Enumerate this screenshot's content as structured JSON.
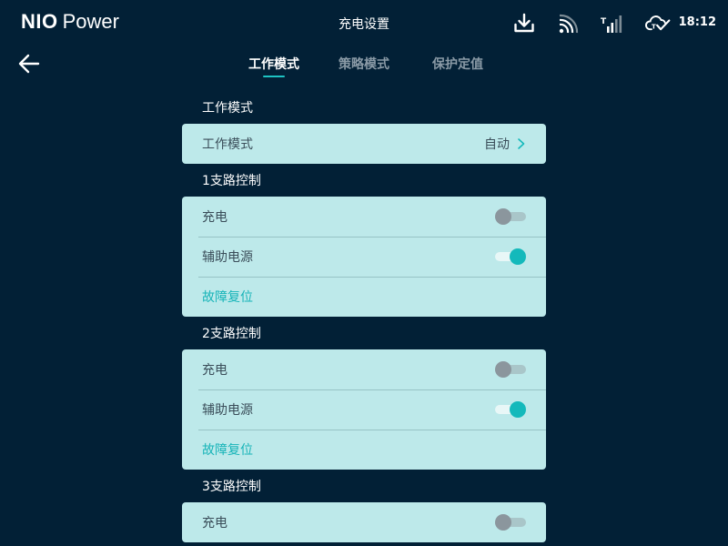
{
  "status_bar": {
    "logo_brand": "NIO",
    "logo_product": "Power",
    "title": "充电设置",
    "time": "18:12",
    "icons": [
      "download-icon",
      "wireless-signal-icon",
      "cellular-signal-icon",
      "cloud-check-icon"
    ]
  },
  "nav": {
    "back_icon": "arrow-left-icon",
    "tabs": [
      {
        "label": "工作模式",
        "active": true
      },
      {
        "label": "策略模式",
        "active": false
      },
      {
        "label": "保护定值",
        "active": false
      }
    ]
  },
  "sections": {
    "work_mode": {
      "label": "工作模式",
      "row_label": "工作模式",
      "row_value": "自动"
    },
    "branch1": {
      "label": "1支路控制",
      "charge_label": "充电",
      "charge_on": false,
      "aux_label": "辅助电源",
      "aux_on": true,
      "reset_label": "故障复位"
    },
    "branch2": {
      "label": "2支路控制",
      "charge_label": "充电",
      "charge_on": false,
      "aux_label": "辅助电源",
      "aux_on": true,
      "reset_label": "故障复位"
    },
    "branch3": {
      "label": "3支路控制",
      "charge_label": "充电",
      "charge_on": false
    }
  },
  "colors": {
    "background": "#022036",
    "card": "#bde9ea",
    "accent": "#14b9bb",
    "toggle_off_thumb": "#8b969d"
  }
}
